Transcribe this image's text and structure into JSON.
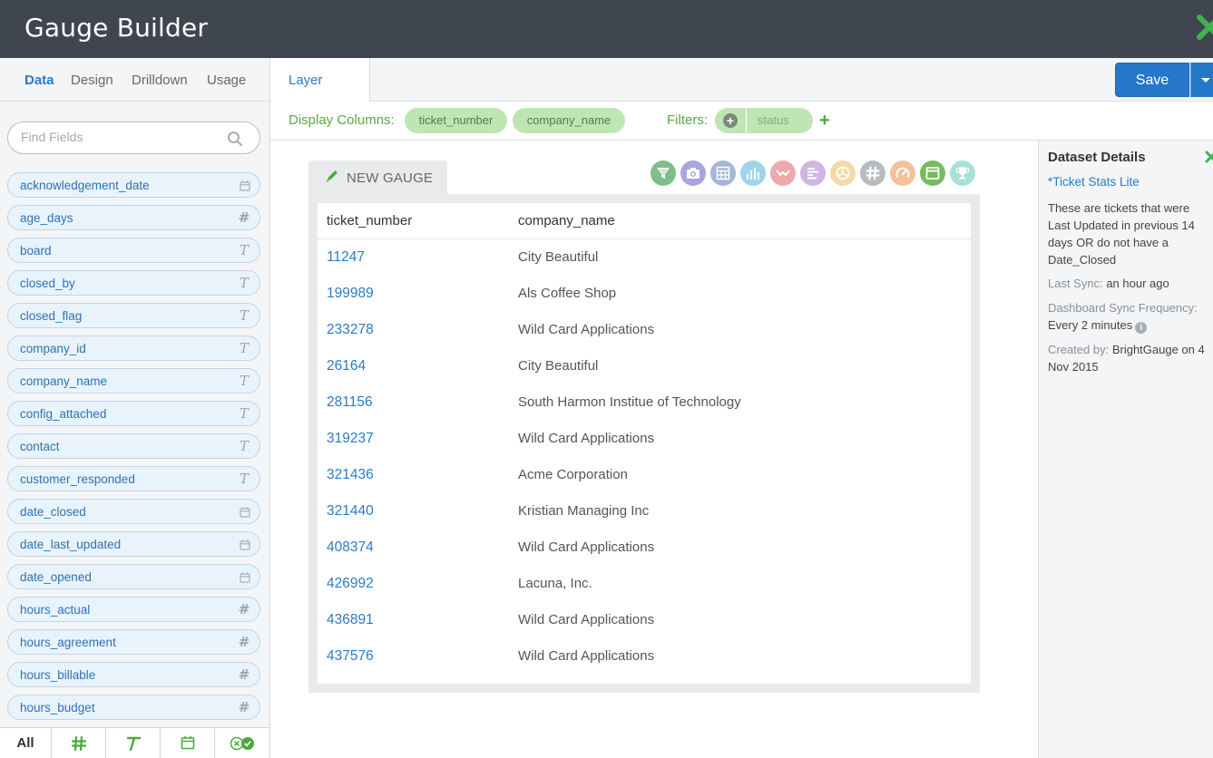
{
  "app": {
    "title": "Gauge Builder"
  },
  "left_tabs": [
    "Data",
    "Design",
    "Drilldown",
    "Usage"
  ],
  "search": {
    "placeholder": "Find Fields"
  },
  "fields": [
    {
      "name": "acknowledgement_date",
      "type": "date"
    },
    {
      "name": "age_days",
      "type": "number"
    },
    {
      "name": "board",
      "type": "text"
    },
    {
      "name": "closed_by",
      "type": "text"
    },
    {
      "name": "closed_flag",
      "type": "text"
    },
    {
      "name": "company_id",
      "type": "text"
    },
    {
      "name": "company_name",
      "type": "text"
    },
    {
      "name": "config_attached",
      "type": "text"
    },
    {
      "name": "contact",
      "type": "text"
    },
    {
      "name": "customer_responded",
      "type": "text"
    },
    {
      "name": "date_closed",
      "type": "date"
    },
    {
      "name": "date_last_updated",
      "type": "date"
    },
    {
      "name": "date_opened",
      "type": "date"
    },
    {
      "name": "hours_actual",
      "type": "number"
    },
    {
      "name": "hours_agreement",
      "type": "number"
    },
    {
      "name": "hours_billable",
      "type": "number"
    },
    {
      "name": "hours_budget",
      "type": "number"
    }
  ],
  "type_symbols": {
    "number": "#",
    "text": "T"
  },
  "bottom_filters": {
    "all_label": "All"
  },
  "layer_tab": "Layer",
  "save_label": "Save",
  "display_columns": {
    "label": "Display Columns:",
    "columns": [
      "ticket_number",
      "company_name"
    ]
  },
  "filters": {
    "label": "Filters:",
    "items": [
      "status"
    ]
  },
  "gauge": {
    "name": "NEW GAUGE",
    "headers": [
      "ticket_number",
      "company_name"
    ],
    "rows": [
      [
        "11247",
        "City Beautiful"
      ],
      [
        "199989",
        "Als Coffee Shop"
      ],
      [
        "233278",
        "Wild Card Applications"
      ],
      [
        "26164",
        "City Beautiful"
      ],
      [
        "281156",
        "South Harmon Institue of Technology"
      ],
      [
        "319237",
        "Wild Card Applications"
      ],
      [
        "321436",
        "Acme Corporation"
      ],
      [
        "321440",
        "Kristian Managing Inc"
      ],
      [
        "408374",
        "Wild Card Applications"
      ],
      [
        "426992",
        "Lacuna, Inc."
      ],
      [
        "436891",
        "Wild Card Applications"
      ],
      [
        "437576",
        "Wild Card Applications"
      ]
    ]
  },
  "viz_icons": [
    {
      "name": "funnel-icon",
      "color": "#7fbe8a"
    },
    {
      "name": "camera-icon",
      "color": "#a9a6dd"
    },
    {
      "name": "table-icon",
      "color": "#a6b6d6"
    },
    {
      "name": "bar-chart-icon",
      "color": "#9fd5ea"
    },
    {
      "name": "line-chart-icon",
      "color": "#eeaaaa"
    },
    {
      "name": "horizontal-bar-icon",
      "color": "#cdb6e2"
    },
    {
      "name": "pie-chart-icon",
      "color": "#f0dba8"
    },
    {
      "name": "number-icon",
      "color": "#b9bcbf"
    },
    {
      "name": "speedometer-icon",
      "color": "#f4c19a"
    },
    {
      "name": "window-icon",
      "color": "#75bd5e"
    },
    {
      "name": "trophy-icon",
      "color": "#a8e2d5"
    }
  ],
  "dataset": {
    "title": "Dataset Details",
    "name": "*Ticket Stats Lite",
    "description": "These are tickets that were Last Updated in previous 14 days OR do not have a Date_Closed",
    "last_sync_label": "Last Sync:",
    "last_sync_value": "an hour ago",
    "frequency_label": "Dashboard Sync Frequency:",
    "frequency_value": "Every 2 minutes",
    "created_label": "Created by:",
    "created_value": "BrightGauge on 4 Nov 2015"
  }
}
